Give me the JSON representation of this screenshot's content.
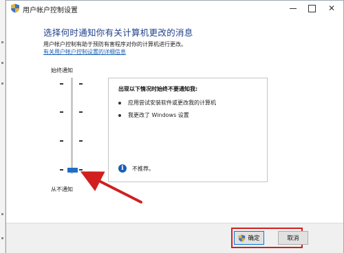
{
  "window": {
    "title": "用户帐户控制设置",
    "controls": {
      "minimize": "—",
      "maximize": "",
      "close": "✕"
    }
  },
  "main": {
    "heading": "选择何时通知你有关计算机更改的消息",
    "description": "用户帐户控制有助于预防有害程序对你的计算机进行更改。",
    "more_link": "有关用户帐户控制设置的详细信息"
  },
  "slider": {
    "top_label": "始终通知",
    "bottom_label": "从不通知",
    "selected_level": 0,
    "level_count": 4
  },
  "panel": {
    "title": "出现以下情况时始终不要通知我:",
    "bullets": [
      "应用尝试安装软件或更改我的计算机",
      "我更改了 Windows 设置"
    ],
    "recommendation": "不推荐。",
    "recommendation_icon": "i"
  },
  "footer": {
    "ok_label": "确定",
    "cancel_label": "取消"
  },
  "colors": {
    "heading": "#1e3f8a",
    "link": "#1a5fb4",
    "slider_thumb": "#1f6ec4",
    "annotation": "#d11f1f"
  },
  "icons": {
    "window_icon": "uac-shield-icon",
    "ok_button_icon": "uac-shield-icon",
    "info_icon": "info-icon"
  }
}
